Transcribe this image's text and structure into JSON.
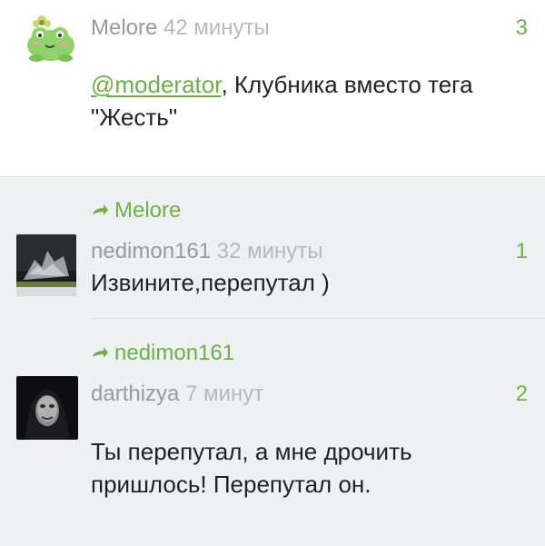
{
  "comments": [
    {
      "author": "Melore",
      "time": "42 минуты",
      "score": "3",
      "mention": "@moderator",
      "text_line1": ", Клубника вместо тега",
      "text_line2": "\"Жесть\""
    },
    {
      "reply_to": "Melore",
      "author": "nedimon161",
      "time": "32 минуты",
      "score": "1",
      "text": "Извините,перепутал )"
    },
    {
      "reply_to": "nedimon161",
      "author": "darthizya",
      "time": "7 минут",
      "score": "2",
      "text_line1": "Ты перепутал, а мне дрочить",
      "text_line2": "пришлось! Перепутал он."
    }
  ],
  "colors": {
    "accent": "#6cb046",
    "reply_background": "#eef0f2",
    "muted_text": "#9a9a9a"
  },
  "icons": {
    "reply_arrow": "reply-arrow-icon"
  }
}
